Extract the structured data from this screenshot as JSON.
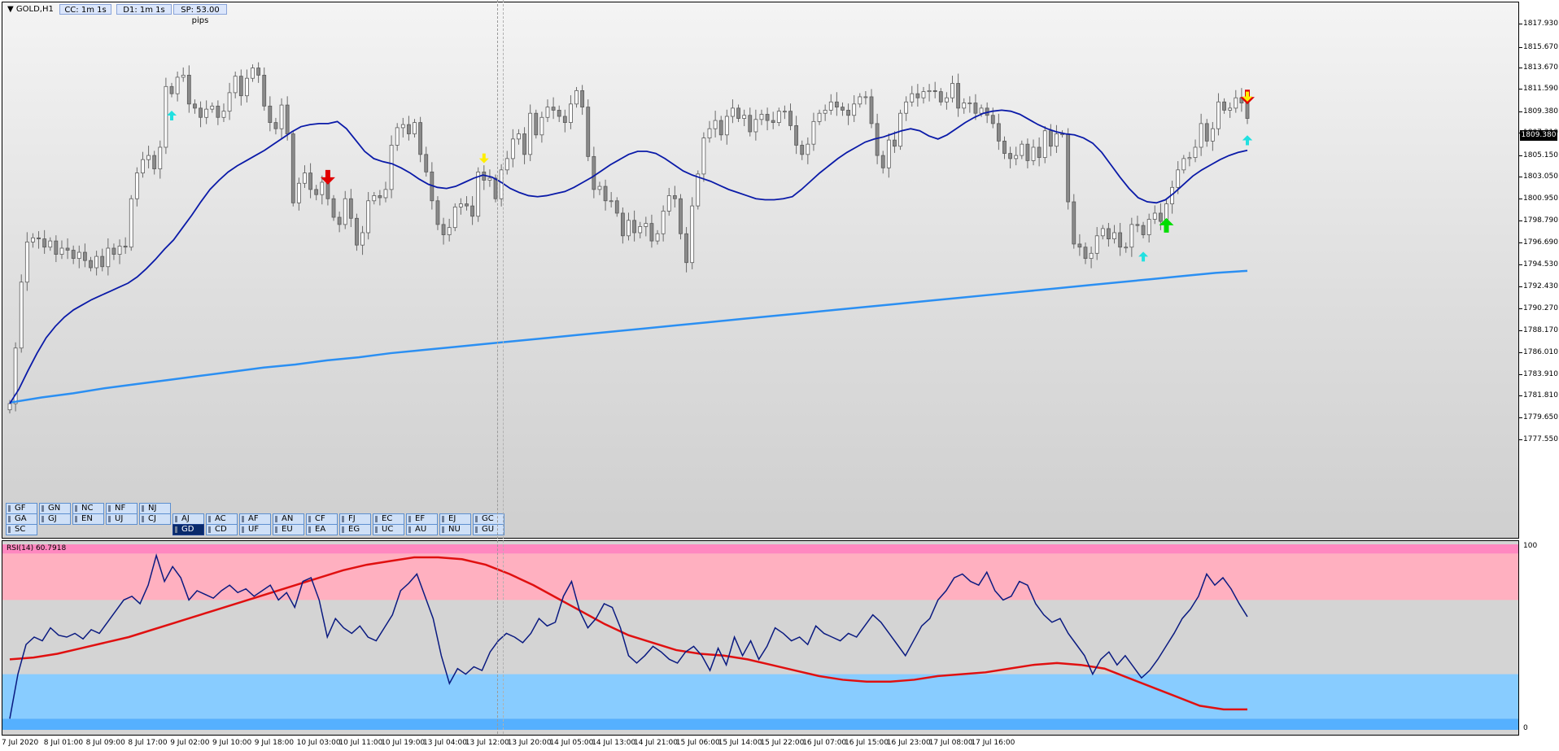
{
  "window": {
    "symbol_title": "GOLD,H1",
    "info_boxes": [
      "CC: 1m 1s",
      "D1: 1m 1s",
      "SP: 53.00 pips"
    ],
    "current_price": "1809.380"
  },
  "price_axis": [
    "1817.930",
    "1815.670",
    "1813.670",
    "1811.590",
    "1809.380",
    "1807.310",
    "1805.150",
    "1803.050",
    "1800.950",
    "1798.790",
    "1796.690",
    "1794.530",
    "1792.430",
    "1790.270",
    "1788.170",
    "1786.010",
    "1783.910",
    "1781.810",
    "1779.650",
    "1777.550"
  ],
  "rsi": {
    "title": "RSI(14) 60.7918",
    "axis_labels": [
      "100",
      "0"
    ]
  },
  "time_axis": [
    "7 Jul 2020",
    "8 Jul 01:00",
    "8 Jul 09:00",
    "8 Jul 17:00",
    "9 Jul 02:00",
    "9 Jul 10:00",
    "9 Jul 18:00",
    "10 Jul 03:00",
    "10 Jul 11:00",
    "10 Jul 19:00",
    "13 Jul 04:00",
    "13 Jul 12:00",
    "13 Jul 20:00",
    "14 Jul 05:00",
    "14 Jul 13:00",
    "14 Jul 21:00",
    "15 Jul 06:00",
    "15 Jul 14:00",
    "15 Jul 22:00",
    "16 Jul 07:00",
    "16 Jul 15:00",
    "16 Jul 23:00",
    "17 Jul 08:00",
    "17 Jul 16:00"
  ],
  "pair_buttons": {
    "row1": [
      "GF",
      "GN",
      "NC",
      "NF",
      "NJ"
    ],
    "row2": [
      "GA",
      "GJ",
      "EN",
      "UJ",
      "CJ",
      "AJ",
      "AC",
      "AF",
      "AN",
      "CF",
      "FJ",
      "EC",
      "EF",
      "EJ",
      "GC"
    ],
    "row3": [
      "SC",
      "GD",
      "CD",
      "UF",
      "EU",
      "EA",
      "EG",
      "UC",
      "AU",
      "NU",
      "GU"
    ],
    "active": "GD"
  },
  "colors": {
    "ma_fast": "#0a1aa8",
    "ma_slow": "#2b8ff2",
    "rsi_line": "#0a1a80",
    "rsi_signal": "#e01010",
    "overbought_zone": "#ffb0c0",
    "overbought_top": "#ff88c0",
    "oversold_zone": "#88ccff",
    "oversold_bottom": "#55b0ff",
    "candle_body": "#8a8a8a",
    "arrow_sell": "#e00000",
    "arrow_buy_strong": "#00dd00",
    "arrow_buy": "#22e0e0",
    "arrow_alert": "#ffee00"
  },
  "chart_data": [
    {
      "type": "candlestick",
      "ylim": [
        1777.55,
        1817.93
      ],
      "y_ticks": [
        1817.93,
        1815.67,
        1813.67,
        1811.59,
        1809.38,
        1807.31,
        1805.15,
        1803.05,
        1800.95,
        1798.79,
        1796.69,
        1794.53,
        1792.43,
        1790.27,
        1788.17,
        1786.01,
        1783.91,
        1781.81,
        1779.65,
        1777.55
      ],
      "close": [
        1781.1,
        1786.5,
        1792.9,
        1796.8,
        1797.2,
        1797.1,
        1796.3,
        1796.9,
        1795.6,
        1796.2,
        1796.0,
        1795.2,
        1795.8,
        1795.0,
        1794.3,
        1795.4,
        1794.4,
        1796.2,
        1795.6,
        1796.4,
        1796.3,
        1801.0,
        1803.5,
        1804.8,
        1805.2,
        1803.9,
        1806.0,
        1811.9,
        1811.2,
        1812.8,
        1813.0,
        1810.2,
        1809.8,
        1808.9,
        1809.7,
        1810.0,
        1808.9,
        1809.5,
        1811.3,
        1812.9,
        1811.0,
        1812.7,
        1813.7,
        1813.0,
        1810.0,
        1808.4,
        1807.8,
        1810.1,
        1807.3,
        1800.6,
        1802.5,
        1803.5,
        1801.9,
        1801.4,
        1802.6,
        1801.0,
        1799.2,
        1798.5,
        1801.0,
        1799.1,
        1796.5,
        1797.7,
        1800.8,
        1801.3,
        1801.1,
        1801.9,
        1806.2,
        1807.9,
        1808.2,
        1807.3,
        1808.4,
        1805.3,
        1803.6,
        1800.8,
        1798.5,
        1797.5,
        1798.2,
        1800.2,
        1800.5,
        1800.3,
        1799.3,
        1803.6,
        1802.8,
        1803.0,
        1801.0,
        1803.8,
        1804.9,
        1806.8,
        1807.3,
        1805.3,
        1809.3,
        1807.2,
        1808.9,
        1809.9,
        1809.6,
        1809.0,
        1808.4,
        1810.2,
        1811.5,
        1809.9,
        1805.1,
        1801.9,
        1802.2,
        1800.8,
        1800.8,
        1799.6,
        1797.4,
        1798.9,
        1797.7,
        1798.3,
        1798.6,
        1796.9,
        1797.6,
        1799.8,
        1801.3,
        1801.0,
        1797.6,
        1794.8,
        1800.3,
        1803.4,
        1806.9,
        1807.8,
        1808.6,
        1807.2,
        1809.0,
        1809.8,
        1808.8,
        1809.1,
        1807.5,
        1808.7,
        1809.2,
        1808.6,
        1808.4,
        1809.5,
        1809.5,
        1808.1,
        1806.2,
        1805.3,
        1806.3,
        1808.5,
        1809.3,
        1809.6,
        1810.4,
        1809.9,
        1809.6,
        1809.1,
        1810.2,
        1810.9,
        1810.9,
        1808.3,
        1805.2,
        1804.0,
        1806.7,
        1806.1,
        1809.3,
        1810.4,
        1811.2,
        1810.8,
        1811.4,
        1811.5,
        1811.4,
        1810.4,
        1810.8,
        1812.2,
        1809.8,
        1810.3,
        1810.3,
        1809.3,
        1809.8,
        1809.1,
        1808.3,
        1806.6,
        1805.4,
        1804.9,
        1805.2,
        1806.3,
        1804.7,
        1806.0,
        1805.0,
        1807.6,
        1806.1,
        1807.3,
        1807.3,
        1800.7,
        1796.6,
        1796.3,
        1795.2,
        1795.7,
        1797.4,
        1798.1,
        1797.1,
        1797.7,
        1796.3,
        1796.3,
        1798.5,
        1798.4,
        1797.5,
        1799.0,
        1799.6,
        1798.8,
        1800.5,
        1802.1,
        1803.8,
        1804.9,
        1805.0,
        1806.0,
        1808.3,
        1806.6,
        1807.8,
        1810.4,
        1809.6,
        1809.8,
        1810.8,
        1810.3,
        1808.8
      ],
      "ma_fast": [
        1781.1,
        1782.5,
        1784.3,
        1786.0,
        1787.5,
        1788.6,
        1789.5,
        1790.2,
        1790.7,
        1791.2,
        1791.6,
        1792.0,
        1792.4,
        1792.8,
        1793.4,
        1794.2,
        1795.1,
        1796.1,
        1797.0,
        1798.2,
        1799.4,
        1800.7,
        1801.9,
        1802.8,
        1803.6,
        1804.2,
        1804.7,
        1805.2,
        1805.7,
        1806.3,
        1806.9,
        1807.5,
        1808.0,
        1808.2,
        1808.3,
        1808.3,
        1808.5,
        1807.8,
        1806.7,
        1805.6,
        1804.9,
        1804.6,
        1804.4,
        1804.0,
        1803.5,
        1802.9,
        1802.4,
        1802.1,
        1802.0,
        1802.2,
        1802.6,
        1803.0,
        1803.3,
        1803.1,
        1802.6,
        1802.0,
        1801.6,
        1801.3,
        1801.2,
        1801.3,
        1801.5,
        1801.7,
        1802.1,
        1802.6,
        1803.1,
        1803.7,
        1804.3,
        1804.8,
        1805.3,
        1805.6,
        1805.6,
        1805.4,
        1804.9,
        1804.3,
        1803.7,
        1803.3,
        1803.0,
        1802.7,
        1802.3,
        1801.9,
        1801.6,
        1801.3,
        1801.0,
        1800.9,
        1800.9,
        1801.0,
        1801.2,
        1801.9,
        1802.7,
        1803.5,
        1804.2,
        1804.9,
        1805.5,
        1806.0,
        1806.5,
        1806.8,
        1807.0,
        1807.3,
        1807.6,
        1807.8,
        1807.6,
        1807.1,
        1806.8,
        1807.2,
        1807.8,
        1808.4,
        1808.9,
        1809.3,
        1809.5,
        1809.6,
        1809.5,
        1809.2,
        1808.7,
        1808.2,
        1807.8,
        1807.5,
        1807.3,
        1807.2,
        1806.9,
        1806.4,
        1805.5,
        1804.3,
        1803.1,
        1802.0,
        1801.1,
        1800.7,
        1800.6,
        1800.9,
        1801.6,
        1802.4,
        1803.2,
        1803.8,
        1804.3,
        1804.8,
        1805.2,
        1805.5,
        1805.7
      ],
      "ma_slow": [
        1781.2,
        1781.7,
        1782.1,
        1782.6,
        1783.0,
        1783.4,
        1783.8,
        1784.2,
        1784.6,
        1784.9,
        1785.3,
        1785.6,
        1786.0,
        1786.3,
        1786.6,
        1786.9,
        1787.2,
        1787.5,
        1787.8,
        1788.1,
        1788.4,
        1788.7,
        1789.0,
        1789.3,
        1789.6,
        1789.9,
        1790.2,
        1790.5,
        1790.8,
        1791.1,
        1791.4,
        1791.7,
        1792.0,
        1792.3,
        1792.6,
        1792.9,
        1793.2,
        1793.5,
        1793.8,
        1794.0
      ],
      "arrows": [
        {
          "kind": "buy",
          "index": 28
        },
        {
          "kind": "sell",
          "index": 55
        },
        {
          "kind": "alert",
          "index": 82
        },
        {
          "kind": "buy",
          "index": 196
        },
        {
          "kind": "buy_strong",
          "index": 200
        },
        {
          "kind": "sell",
          "index": 237
        },
        {
          "kind": "alert",
          "index": 257
        },
        {
          "kind": "alert",
          "index": 266
        },
        {
          "kind": "buy",
          "index": 292
        },
        {
          "kind": "buy",
          "index": 301
        },
        {
          "kind": "buy",
          "index": 309
        },
        {
          "kind": "buy",
          "index": 320
        },
        {
          "kind": "alert",
          "index": 331
        }
      ]
    },
    {
      "type": "line",
      "title": "RSI(14) 60.7918",
      "ylim": [
        0,
        100
      ],
      "overbought": 70,
      "oversold": 30,
      "series": [
        {
          "name": "RSI(14)",
          "values": [
            6,
            30,
            46,
            50,
            48,
            55,
            51,
            50,
            52,
            49,
            54,
            52,
            58,
            64,
            70,
            72,
            68,
            78,
            94,
            80,
            88,
            82,
            70,
            75,
            73,
            71,
            75,
            78,
            74,
            76,
            72,
            75,
            78,
            70,
            74,
            66,
            80,
            82,
            70,
            50,
            60,
            55,
            52,
            56,
            50,
            48,
            55,
            62,
            75,
            79,
            84,
            72,
            60,
            40,
            25,
            33,
            30,
            34,
            32,
            42,
            48,
            52,
            50,
            47,
            52,
            60,
            56,
            58,
            72,
            80,
            64,
            55,
            60,
            68,
            66,
            55,
            40,
            36,
            40,
            45,
            42,
            38,
            36,
            42,
            45,
            40,
            32,
            44,
            35,
            50,
            40,
            48,
            38,
            45,
            55,
            52,
            48,
            50,
            46,
            56,
            52,
            50,
            48,
            52,
            50,
            56,
            62,
            58,
            52,
            46,
            40,
            48,
            56,
            60,
            70,
            75,
            82,
            84,
            80,
            78,
            85,
            75,
            70,
            72,
            80,
            78,
            68,
            62,
            58,
            60,
            52,
            46,
            40,
            30,
            38,
            42,
            35,
            40,
            34,
            28,
            32,
            38,
            45,
            52,
            60,
            65,
            72,
            84,
            78,
            82,
            76,
            68,
            61
          ]
        },
        {
          "name": "Signal",
          "values": [
            38,
            39,
            41,
            44,
            47,
            50,
            54,
            58,
            62,
            66,
            70,
            74,
            78,
            82,
            86,
            89,
            91,
            93,
            93,
            92,
            89,
            84,
            78,
            71,
            64,
            57,
            51,
            47,
            43,
            41,
            40,
            38,
            35,
            32,
            29,
            27,
            26,
            26,
            27,
            29,
            30,
            31,
            33,
            35,
            36,
            35,
            33,
            28,
            23,
            18,
            13,
            11,
            11
          ]
        }
      ]
    }
  ]
}
